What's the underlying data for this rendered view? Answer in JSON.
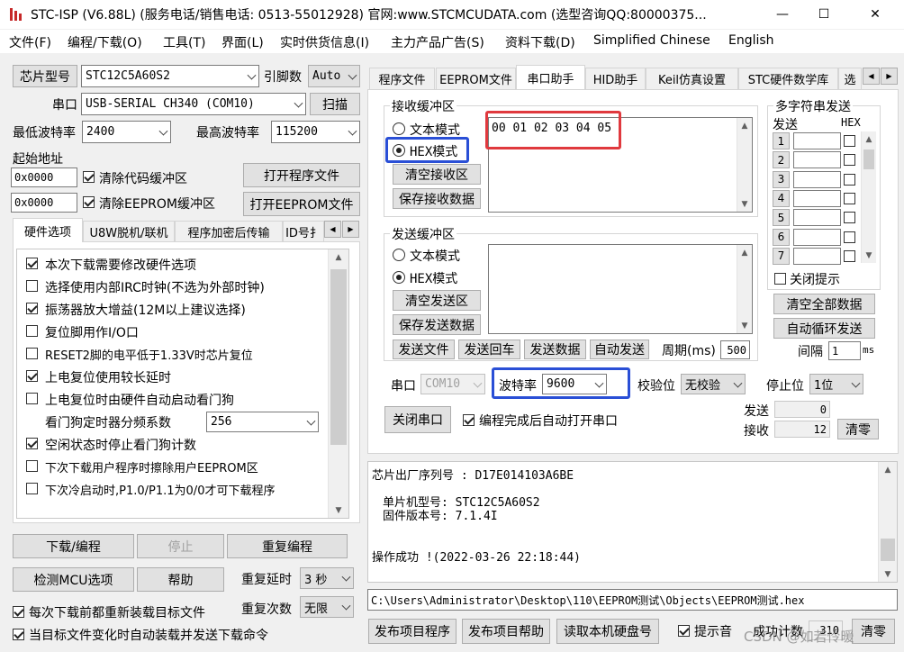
{
  "window": {
    "title": "STC-ISP (V6.88L) (服务电话/销售电话: 0513-55012928) 官网:www.STCMCUDATA.com  (选型咨询QQ:80000375...",
    "controls": {
      "minimize": "—",
      "maximize": "☐",
      "close": "✕"
    }
  },
  "menu": [
    "文件(F)",
    "编程/下载(O)",
    "工具(T)",
    "界面(L)",
    "实时供货信息(I)",
    "主力产品广告(S)",
    "资料下载(D)",
    "Simplified Chinese",
    "English"
  ],
  "left": {
    "chip_button": "芯片型号",
    "chip_value": "STC12C5A60S2",
    "pin_label": "引脚数",
    "pin_value": "Auto",
    "port_label": "串口",
    "port_value": "USB-SERIAL CH340 (COM10)",
    "scan_button": "扫描",
    "min_baud_label": "最低波特率",
    "min_baud_value": "2400",
    "max_baud_label": "最高波特率",
    "max_baud_value": "115200",
    "start_addr_label": "起始地址",
    "addr1": "0x0000",
    "clear_code_label": "清除代码缓冲区",
    "open_prog_button": "打开程序文件",
    "addr2": "0x0000",
    "clear_eeprom_label": "清除EEPROM缓冲区",
    "open_eeprom_button": "打开EEPROM文件",
    "tabs": [
      "硬件选项",
      "U8W脱机/联机",
      "程序加密后传输",
      "ID号扌"
    ],
    "options": [
      {
        "label": "本次下载需要修改硬件选项",
        "checked": true
      },
      {
        "label": "选择使用内部IRC时钟(不选为外部时钟)",
        "checked": false
      },
      {
        "label": "振荡器放大增益(12M以上建议选择)",
        "checked": true
      },
      {
        "label": "复位脚用作I/O口",
        "checked": false
      },
      {
        "label": "RESET2脚的电平低于1.33V时芯片复位",
        "checked": false
      },
      {
        "label": "上电复位使用较长延时",
        "checked": true
      },
      {
        "label": "上电复位时由硬件自动启动看门狗",
        "checked": false
      }
    ],
    "watchdog_label": "看门狗定时器分频系数",
    "watchdog_value": "256",
    "options2": [
      {
        "label": "空闲状态时停止看门狗计数",
        "checked": true
      },
      {
        "label": "下次下载用户程序时擦除用户EEPROM区",
        "checked": false
      },
      {
        "label": "下次冷启动时,P1.0/P1.1为0/0才可下载程序",
        "checked": false
      }
    ],
    "download_button": "下载/编程",
    "stop_button": "停止",
    "reprogram_button": "重复编程",
    "check_mcu_button": "检测MCU选项",
    "help_button": "帮助",
    "repeat_delay_label": "重复延时",
    "repeat_delay_value": "3 秒",
    "repeat_count_label": "重复次数",
    "repeat_count_value": "无限",
    "reload_label": "每次下载前都重新装载目标文件",
    "reload_checked": true,
    "autoload_label": "当目标文件变化时自动装载并发送下载命令",
    "autoload_checked": true
  },
  "right": {
    "tabs": [
      "程序文件",
      "EEPROM文件",
      "串口助手",
      "HID助手",
      "Keil仿真设置",
      "STC硬件数学库",
      "选"
    ],
    "receive": {
      "title": "接收缓冲区",
      "text_mode": "文本模式",
      "hex_mode": "HEX模式",
      "hex_selected": true,
      "clear_button": "清空接收区",
      "save_button": "保存接收数据",
      "content": "00 01 02 03 04 05"
    },
    "send": {
      "title": "发送缓冲区",
      "text_mode": "文本模式",
      "hex_mode": "HEX模式",
      "hex_selected": true,
      "clear_button": "清空发送区",
      "save_button": "保存发送数据",
      "content": "",
      "send_file": "发送文件",
      "send_enter": "发送回车",
      "send_data": "发送数据",
      "auto_send": "自动发送",
      "period_label": "周期(ms)",
      "period_value": "500"
    },
    "multi": {
      "title": "多字符串发送",
      "send_header": "发送",
      "hex_header": "HEX",
      "rows": [
        "1",
        "2",
        "3",
        "4",
        "5",
        "6",
        "7"
      ],
      "close_prompt": "关闭提示",
      "clear_all": "清空全部数据",
      "auto_loop": "自动循环发送",
      "interval_label": "间隔",
      "interval_value": "1",
      "interval_unit": "ms"
    },
    "serial": {
      "port_label": "串口",
      "port_value": "COM10",
      "baud_label": "波特率",
      "baud_value": "9600",
      "parity_label": "校验位",
      "parity_value": "无校验",
      "stop_label": "停止位",
      "stop_value": "1位",
      "close_button": "关闭串口",
      "auto_open_label": "编程完成后自动打开串口",
      "auto_open_checked": true,
      "sent_label": "发送",
      "sent_value": "0",
      "recv_label": "接收",
      "recv_value": "12",
      "clear_counter": "清零"
    },
    "log": {
      "line1": "芯片出厂序列号 : D17E014103A6BE",
      "line2": "单片机型号: STC12C5A60S2",
      "line3": "固件版本号: 7.1.4I",
      "line4": "操作成功 !(2022-03-26 22:18:44)"
    },
    "path": "C:\\Users\\Administrator\\Desktop\\110\\EEPROM测试\\Objects\\EEPROM测试.hex",
    "bottom": {
      "publish_button": "发布项目程序",
      "publish_help_button": "发布项目帮助",
      "read_disk_button": "读取本机硬盘号",
      "tone_label": "提示音",
      "tone_checked": true,
      "success_count_label": "成功计数",
      "success_count_value": "310",
      "clear_button": "清零"
    },
    "watermark": "CSDN @如若怜暖"
  },
  "colors": {
    "highlight_red": "#e0393e",
    "highlight_blue": "#2a4fd6"
  }
}
